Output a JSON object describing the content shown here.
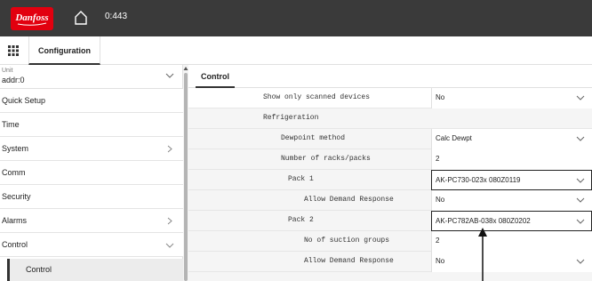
{
  "header": {
    "address": "0:443"
  },
  "tabbar": {
    "tab_label": "Configuration"
  },
  "sidebar": {
    "unit_label": "Unit",
    "unit_value": "addr:0",
    "items": [
      {
        "label": "Quick Setup"
      },
      {
        "label": "Time"
      },
      {
        "label": "System"
      },
      {
        "label": "Comm"
      },
      {
        "label": "Security"
      },
      {
        "label": "Alarms"
      },
      {
        "label": "Control"
      }
    ],
    "sub_item": "Control"
  },
  "main": {
    "tab_label": "Control",
    "rows": [
      {
        "label": "Show only scanned devices",
        "value": "No"
      },
      {
        "label": "Refrigeration"
      },
      {
        "label": "Dewpoint method",
        "value": "Calc Dewpt"
      },
      {
        "label": "Number of racks/packs",
        "value": "2"
      },
      {
        "label": "Pack 1",
        "value": "AK-PC730-023x 080Z0119"
      },
      {
        "label": "Allow Demand Response",
        "value": "No"
      },
      {
        "label": "Pack 2",
        "value": "AK-PC782AB-038x 080Z0202"
      },
      {
        "label": "No of suction groups",
        "value": "2"
      },
      {
        "label": "Allow Demand Response",
        "value": "No"
      }
    ]
  },
  "colors": {
    "topbar": "#3a3a3a",
    "brand": "#e2000f"
  }
}
